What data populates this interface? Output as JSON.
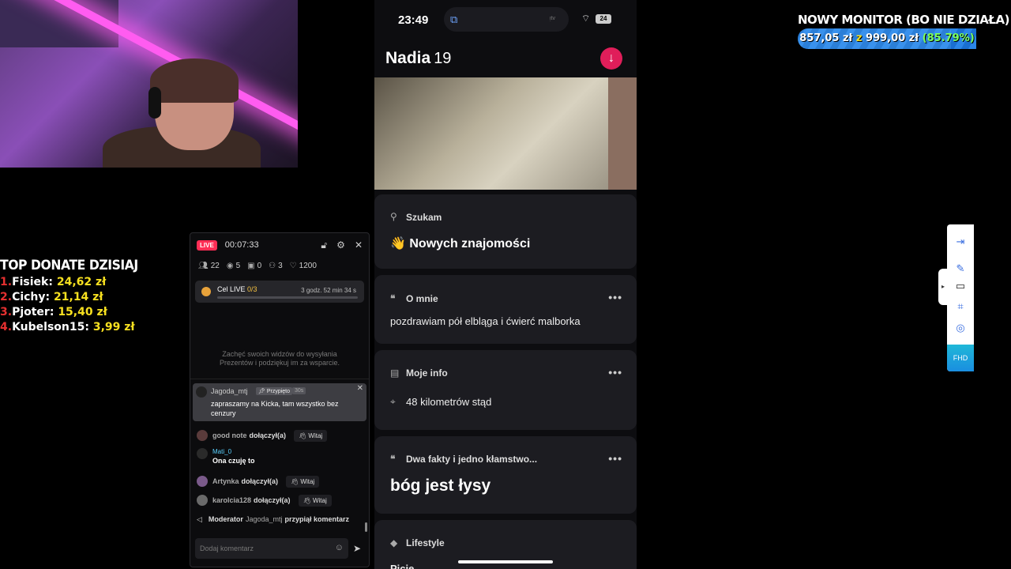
{
  "top_donate": {
    "title": "TOP DONATE DZISIAJ",
    "entries": [
      {
        "rank": "1.",
        "name": "Fisiek:",
        "amount": "24,62 zł"
      },
      {
        "rank": "2.",
        "name": "Cichy:",
        "amount": "21,14 zł"
      },
      {
        "rank": "3.",
        "name": "Pjoter:",
        "amount": "15,40 zł"
      },
      {
        "rank": "4.",
        "name": "Kubelson15:",
        "amount": "3,99 zł"
      }
    ]
  },
  "goal": {
    "title": "NOWY MONITOR (BO NIE DZIAŁA)",
    "current": "857,05 zł",
    "separator": "z",
    "target": "999,00 zł",
    "percent": "(85.79%)",
    "progress": 0.8579
  },
  "live_panel": {
    "badge": "LIVE",
    "timer": "00:07:33",
    "stats": {
      "viewers": "22",
      "views": "5",
      "gifts": "0",
      "followers": "3",
      "likes": "1200"
    },
    "goal_card": {
      "label": "Cel LIVE",
      "count": "0/3",
      "time_left": "3 godz. 52 min 34 s"
    },
    "encourage_text": "Zachęć swoich widzów do wysyłania Prezentów i podziękuj im za wsparcie.",
    "pinned": {
      "user": "Jagoda_mtj",
      "tag": "Przypięto",
      "age": "30s",
      "message": "zapraszamy na Kicka, tam wszystko bez cenzury"
    },
    "chat": [
      {
        "type": "join",
        "name": "good note",
        "text": "dołączył(a)",
        "button": "Witaj",
        "avatar_color": "#5a3b3b"
      },
      {
        "type": "message",
        "name": "Mati_0",
        "text": "Ona czuję to",
        "avatar_color": "#2a2a2a"
      },
      {
        "type": "join",
        "name": "Artynka",
        "text": "dołączył(a)",
        "button": "Witaj",
        "avatar_color": "#7a5a8a"
      },
      {
        "type": "join",
        "name": "karolcia128",
        "text": "dołączył(a)",
        "button": "Witaj",
        "avatar_color": "#6a6a6a"
      }
    ],
    "moderator_line": {
      "label": "Moderator",
      "name": "Jagoda_mtj",
      "text": "przypiął komentarz"
    },
    "input_placeholder": "Dodaj komentarz"
  },
  "phone": {
    "status_time": "23:49",
    "tv_label": "ᴉtv",
    "battery": "24",
    "profile_name": "Nadia",
    "profile_age": "19",
    "cards": {
      "looking_title": "Szukam",
      "looking_value": "Nowych znajomości",
      "about_title": "O mnie",
      "about_value": "pozdrawiam pół elbląga i ćwierć malborka",
      "info_title": "Moje info",
      "info_value": "48 kilometrów stąd",
      "facts_title": "Dwa fakty i jedno kłamstwo...",
      "facts_value": "bóg jest łysy",
      "lifestyle_title": "Lifestyle",
      "lifestyle_value": "Picie"
    }
  },
  "toolbar": {
    "fhd_label": "FHD"
  }
}
